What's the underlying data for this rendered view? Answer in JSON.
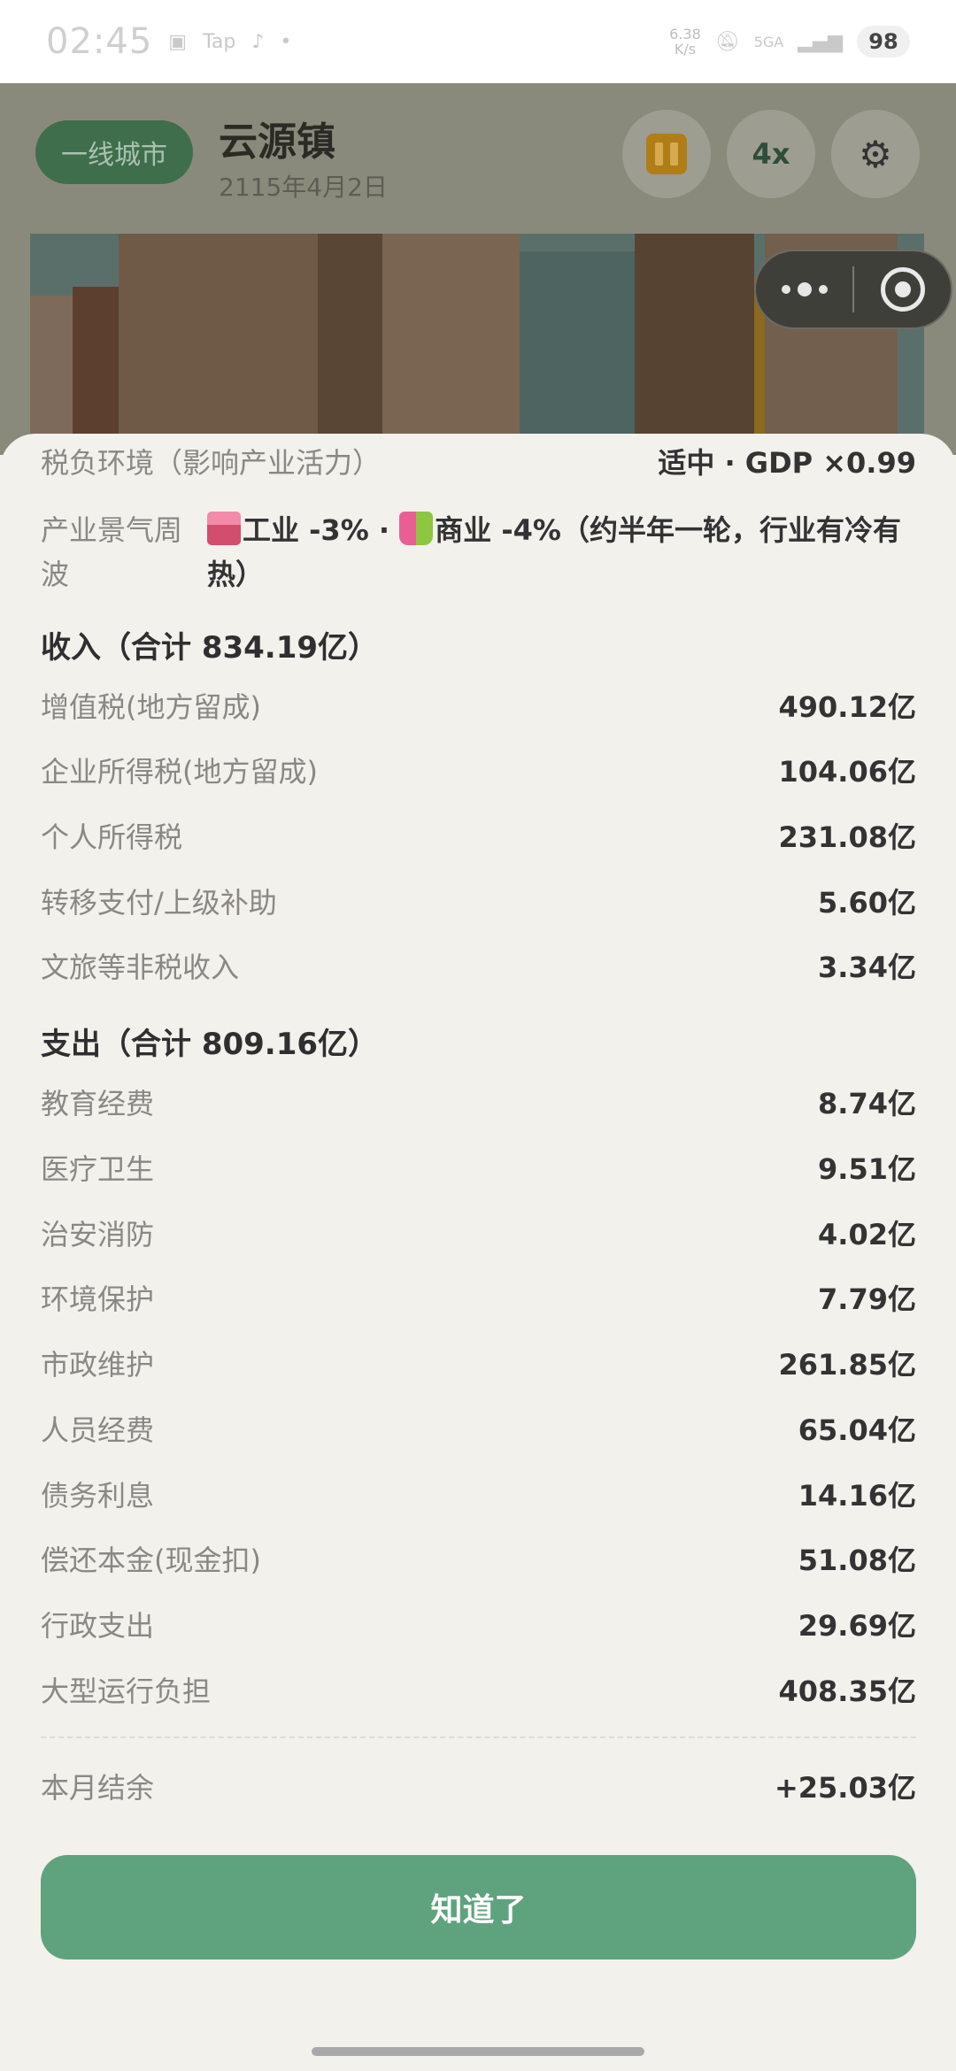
{
  "status_bar": {
    "time": "02:45",
    "tap_label": "Tap",
    "speed_value": "6.38",
    "speed_unit": "K/s",
    "network": "5GA",
    "battery": "98"
  },
  "game": {
    "city_tier": "一线城市",
    "town_name": "云源镇",
    "date": "2115年4月2日",
    "speed_label": "4x",
    "icons": [
      "pause-icon",
      "gear-icon",
      "more-icon",
      "close-target-icon"
    ]
  },
  "sheet": {
    "tax_env_label": "税负环境（影响产业活力）",
    "tax_env_value": "适中 · GDP ×0.99",
    "cycle_label": "产业景气周波",
    "cycle_industry": "工业 -3% · ",
    "cycle_commerce": "商业 -4%（约半年一轮，行业有冷有热）",
    "income_heading": "收入（合计 834.19亿）",
    "income_items": [
      {
        "label": "增值税(地方留成)",
        "value": "490.12亿"
      },
      {
        "label": "企业所得税(地方留成)",
        "value": "104.06亿"
      },
      {
        "label": "个人所得税",
        "value": "231.08亿"
      },
      {
        "label": "转移支付/上级补助",
        "value": "5.60亿"
      },
      {
        "label": "文旅等非税收入",
        "value": "3.34亿"
      }
    ],
    "expense_heading": "支出（合计 809.16亿）",
    "expense_items": [
      {
        "label": "教育经费",
        "value": "8.74亿"
      },
      {
        "label": "医疗卫生",
        "value": "9.51亿"
      },
      {
        "label": "治安消防",
        "value": "4.02亿"
      },
      {
        "label": "环境保护",
        "value": "7.79亿"
      },
      {
        "label": "市政维护",
        "value": "261.85亿"
      },
      {
        "label": "人员经费",
        "value": "65.04亿"
      },
      {
        "label": "债务利息",
        "value": "14.16亿"
      },
      {
        "label": "偿还本金(现金扣)",
        "value": "51.08亿"
      },
      {
        "label": "行政支出",
        "value": "29.69亿"
      },
      {
        "label": "大型运行负担",
        "value": "408.35亿"
      }
    ],
    "balance_label": "本月结余",
    "balance_value": "+25.03亿",
    "ok_button": "知道了"
  }
}
